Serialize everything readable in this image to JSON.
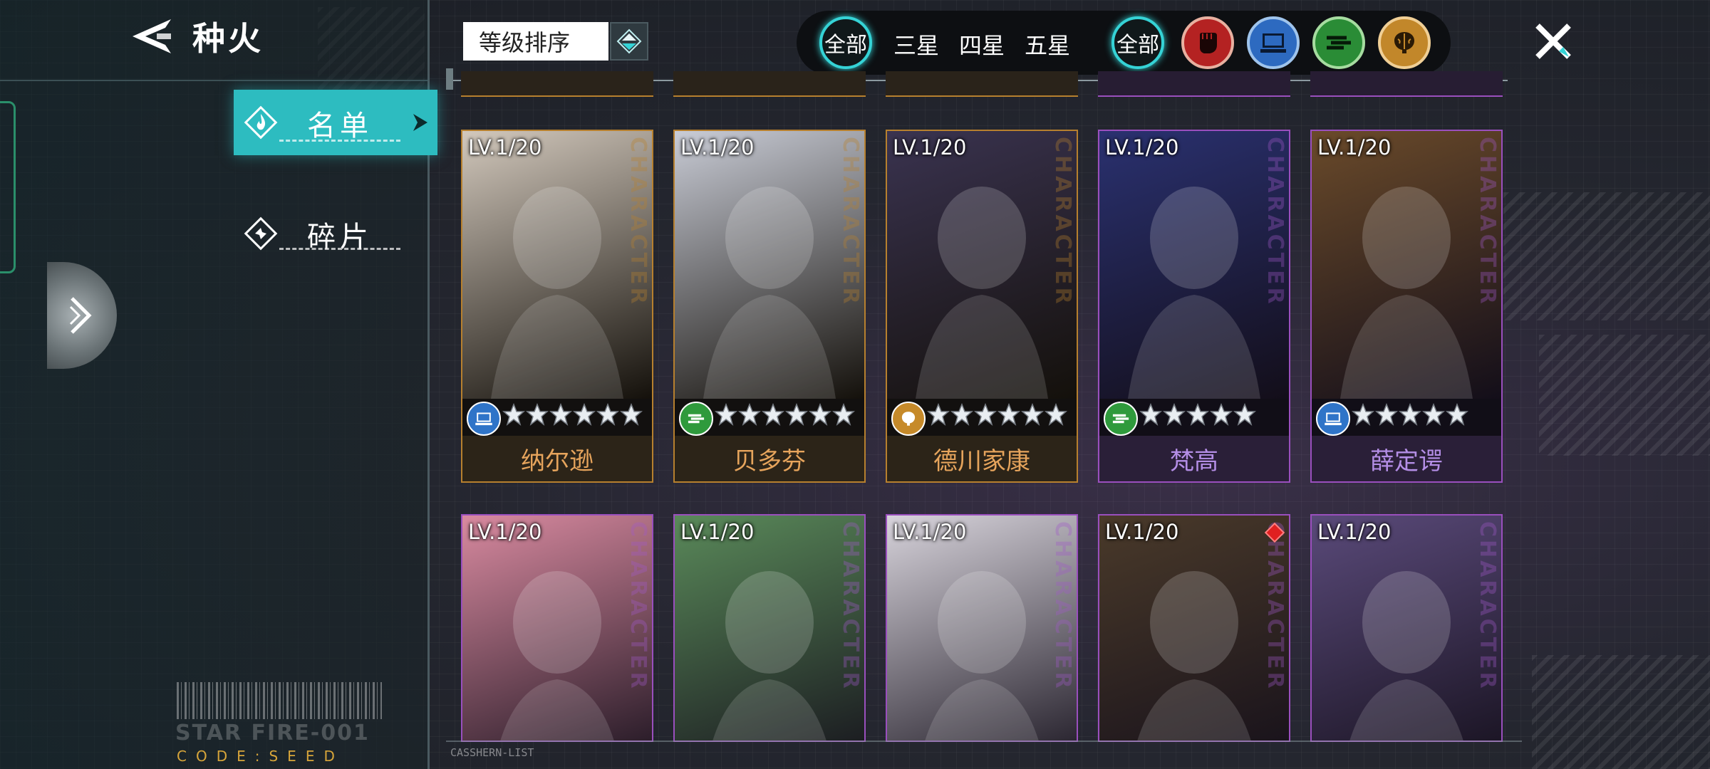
{
  "header": {
    "title": "种火",
    "back_icon": "back-arrow-icon"
  },
  "sidebar": {
    "tabs": [
      {
        "label": "名单",
        "icon": "fire-diamond-icon",
        "active": true
      },
      {
        "label": "碎片",
        "icon": "shard-diamond-icon",
        "active": false
      }
    ]
  },
  "branding": {
    "code_title": "STAR FIRE-001",
    "code_sub": "CODE:SEED",
    "list_tag": "CASSHERN-LIST"
  },
  "sort": {
    "value": "等级排序"
  },
  "filters": {
    "rarity": [
      "全部",
      "三星",
      "四星",
      "五星"
    ],
    "class_all": "全部",
    "classes": [
      {
        "icon": "fist-icon",
        "color": "#c62a2a"
      },
      {
        "icon": "computer-icon",
        "color": "#2f74c8"
      },
      {
        "icon": "speed-lines-icon",
        "color": "#2f9a3c"
      },
      {
        "icon": "brain-icon",
        "color": "#c68a2a"
      }
    ]
  },
  "cards": [
    {
      "level": "LV.1/20",
      "name": "纳尔逊",
      "rarity": "gold",
      "class": "computer-icon",
      "class_color": "#2f74c8",
      "stars": 6,
      "side": "CHARACTER",
      "bg": "#d2c8bc"
    },
    {
      "level": "LV.1/20",
      "name": "贝多芬",
      "rarity": "gold",
      "class": "speed-lines-icon",
      "class_color": "#2f9a3c",
      "stars": 6,
      "side": "CHARACTER",
      "bg": "#c9ccd6"
    },
    {
      "level": "LV.1/20",
      "name": "德川家康",
      "rarity": "gold",
      "class": "brain-icon",
      "class_color": "#c68a2a",
      "stars": 6,
      "side": "CHARACTER",
      "bg": "#3a3350"
    },
    {
      "level": "LV.1/20",
      "name": "梵高",
      "rarity": "purple",
      "class": "speed-lines-icon",
      "class_color": "#2f9a3c",
      "stars": 5,
      "side": "CHARACTER",
      "bg": "#2a3170"
    },
    {
      "level": "LV.1/20",
      "name": "薛定谔",
      "rarity": "purple",
      "class": "computer-icon",
      "class_color": "#2f74c8",
      "stars": 5,
      "side": "CHARACTER",
      "bg": "#6a4a2a"
    },
    {
      "level": "LV.1/20",
      "name": "",
      "rarity": "purple",
      "side": "CHARACTER",
      "bg": "#d98aa0"
    },
    {
      "level": "LV.1/20",
      "name": "",
      "rarity": "purple",
      "side": "CHARACTER",
      "bg": "#5a8a5a"
    },
    {
      "level": "LV.1/20",
      "name": "",
      "rarity": "purple",
      "side": "CHARACTER",
      "bg": "#d8d4dc"
    },
    {
      "level": "LV.1/20",
      "name": "",
      "rarity": "purple",
      "side": "CHARACTER",
      "bg": "#4a3a2a",
      "marked": true
    },
    {
      "level": "LV.1/20",
      "name": "",
      "rarity": "purple",
      "side": "CHARACTER",
      "bg": "#5a4a7a"
    }
  ]
}
